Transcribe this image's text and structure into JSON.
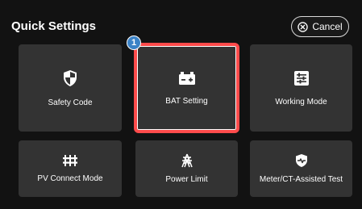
{
  "header": {
    "title": "Quick Settings",
    "cancel_label": "Cancel"
  },
  "tiles": [
    {
      "label": "Safety Code",
      "icon": "shield-icon"
    },
    {
      "label": "BAT Setting",
      "icon": "battery-icon",
      "selected": true
    },
    {
      "label": "Working Mode",
      "icon": "sliders-icon"
    },
    {
      "label": "PV Connect Mode",
      "icon": "pv-connect-icon"
    },
    {
      "label": "Power Limit",
      "icon": "power-tower-icon"
    },
    {
      "label": "Meter/CT-Assisted Test",
      "icon": "heart-shield-icon"
    }
  ],
  "step_badge": "1",
  "colors": {
    "background": "#121212",
    "tile": "#333333",
    "highlight": "#ff4b4b",
    "badge": "#3b82c6"
  }
}
